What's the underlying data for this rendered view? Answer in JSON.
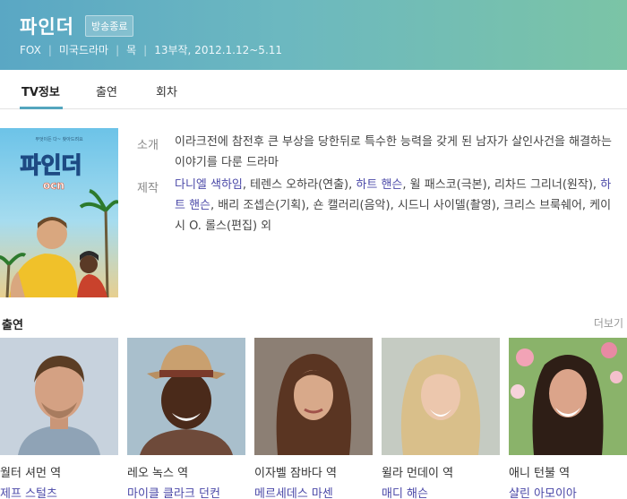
{
  "header": {
    "title": "파인더",
    "badge": "방송종료",
    "meta": [
      "FOX",
      "미국드라마",
      "목",
      "13부작, 2012.1.12~5.11"
    ]
  },
  "tabs": [
    {
      "label": "TV정보",
      "active": true
    },
    {
      "label": "출연",
      "active": false
    },
    {
      "label": "회차",
      "active": false
    }
  ],
  "poster": {
    "small_text": "무엇이든 다~ 찾아드려요",
    "logo_text": "파인더",
    "channel": "ocn"
  },
  "info": {
    "intro_label": "소개",
    "intro_text": "이라크전에 참전후 큰 부상을 당한뒤로 특수한 능력을 갖게 된 남자가 살인사건을 해결하는 이야기를 다룬 드라마",
    "production_label": "제작",
    "production_parts": [
      {
        "text": "다니엘 색하임",
        "link": true
      },
      {
        "text": ", 테렌스 오하라(연출), ",
        "link": false
      },
      {
        "text": "하트 핸슨",
        "link": true
      },
      {
        "text": ", 윌 패스코(극본), 리차드 그리너(원작), ",
        "link": false
      },
      {
        "text": "하트 핸슨",
        "link": true
      },
      {
        "text": ", 배리 조셉슨(기획), 숀 캘러리(음악), 시드니 사이델(촬영), 크리스 브룩쉐어, 케이시 O. 롤스(편집) 외",
        "link": false
      }
    ]
  },
  "cast_section": {
    "heading": "출연",
    "more": "더보기",
    "members": [
      {
        "role": "월터 셔먼 역",
        "actor": "제프 스털츠"
      },
      {
        "role": "레오 녹스 역",
        "actor": "마이클 클라크 던컨"
      },
      {
        "role": "이자벨 잠바다 역",
        "actor": "메르세데스 마센"
      },
      {
        "role": "윌라 먼데이 역",
        "actor": "매디 해슨"
      },
      {
        "role": "애니 턴불 역",
        "actor": "샬린 아모이아"
      }
    ]
  },
  "colors": {
    "accent": "#54a6be",
    "link": "#4b49a8",
    "banner_left": "#5aa7c4",
    "banner_right": "#7bc4a6"
  }
}
